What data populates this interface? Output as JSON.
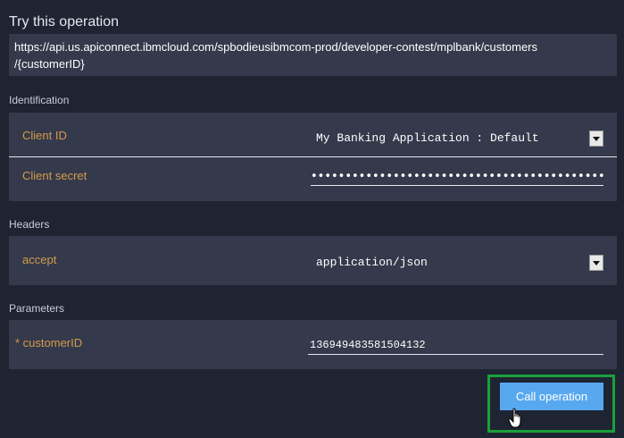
{
  "title": "Try this operation",
  "url": {
    "line1": "https://api.us.apiconnect.ibmcloud.com/spbodieusibmcom-prod/developer-contest/mplbank/customers",
    "line2": "/{customerID}"
  },
  "identification": {
    "label": "Identification",
    "client_id_label": "Client ID",
    "client_id_value": "My Banking Application : Default",
    "client_secret_label": "Client secret",
    "client_secret_value": "••••••••••••••••••••••••••••••••••••••••••••••••"
  },
  "headers": {
    "label": "Headers",
    "accept_label": "accept",
    "accept_value": "application/json"
  },
  "parameters": {
    "label": "Parameters",
    "customer_id_label": "* customerID",
    "customer_id_value": "136949483581504132"
  },
  "call_button": "Call operation",
  "colors": {
    "background": "#1f2433",
    "panel": "#343a4b",
    "label_orange": "#d69a4a",
    "button_blue": "#58a8ef",
    "highlight_green": "#1aa03a"
  },
  "icons": {
    "dropdown": "chevron-down-icon",
    "cursor": "hand-pointer-icon"
  }
}
